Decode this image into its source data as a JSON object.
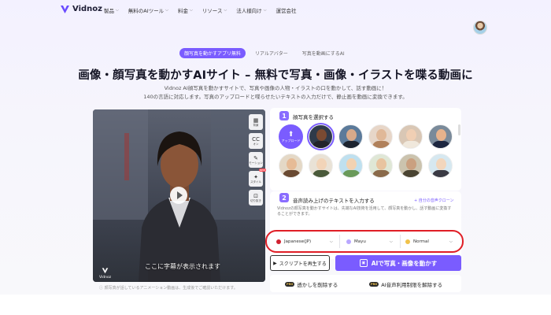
{
  "nav": {
    "logo": "Vidnoz",
    "items": [
      "製品",
      "無料のAIツール",
      "料金",
      "リソース",
      "法人様向け",
      "運営会社"
    ]
  },
  "tabs": [
    "顔写真を動かすアプリ無料",
    "リアルアバター",
    "写真を動画にするAI"
  ],
  "hero": {
    "title": "画像・顔写真を動かすAIサイト – 無料で写真・画像・イラストを喋る動画に",
    "sub1": "Vidnoz AI顔写真を動かすサイトで、写真や画像の人物・イラストの口を動かして、話す動画に！",
    "sub2": "140の言語に対応します。写真のアップロードと喋らせたいテキストの入力だけで、静止画を動画に変換できます。"
  },
  "video": {
    "caption": "ここに字幕が表示されます",
    "logo_text": "Vidnoz",
    "notice": "顔写真が話しているアニメーション動画は、生成後でご確認いただけます。"
  },
  "tools": [
    {
      "icon": "bg",
      "label": "背景"
    },
    {
      "icon": "CC",
      "label": "オン"
    },
    {
      "icon": "✎",
      "label": "モーション"
    },
    {
      "icon": "✦",
      "label": "スタイル",
      "badge": "NEW"
    },
    {
      "icon": "⊡",
      "label": "切り抜き"
    }
  ],
  "step1": {
    "num": "1",
    "title": "顔写真を選択する",
    "upload": "アップロード"
  },
  "step2": {
    "num": "2",
    "title": "音声読み上げのテキストを入力する",
    "clone": "+ 自分の音声クローン",
    "text": "Vidnozの顔写真を動かすサイトは、先端なAI技術を活用して、顔写真を動かし、話す動画に変換することができます。"
  },
  "selects": {
    "language": "Japanese(JP)",
    "voice": "Mayu",
    "style": "Normal"
  },
  "buttons": {
    "script": "スクリプトを再生する",
    "main": "AIで写真・画像を動かす"
  },
  "pro": {
    "watermark": "透かしを削除する",
    "limit": "AI音声利用制限を解除する",
    "badge": "PRO"
  },
  "colors": {
    "accent": "#7a5cff",
    "highlight": "#e01e26"
  }
}
